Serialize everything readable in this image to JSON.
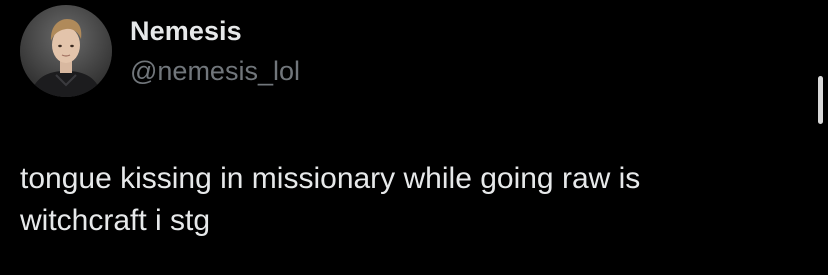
{
  "author": {
    "display_name": "Nemesis",
    "handle": "@nemesis_lol"
  },
  "tweet": {
    "text": "tongue kissing in missionary while going raw is\nwitchcraft i stg"
  },
  "icons": {
    "avatar": "user-avatar-photo",
    "scrollbar": "scrollbar-thumb"
  },
  "colors": {
    "background": "#000000",
    "primary_text": "#e7e9ea",
    "secondary_text": "#71767b"
  }
}
